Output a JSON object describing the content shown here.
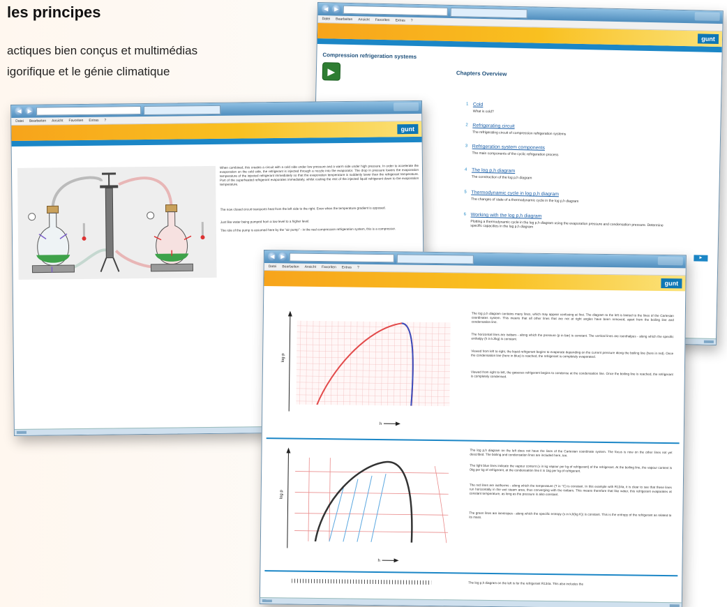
{
  "brochure": {
    "heading": "les principes",
    "line1": "actiques bien conçus et multimédias",
    "line2": "igorifique et le génie climatique"
  },
  "logo": "gunt",
  "menu": [
    "Datei",
    "Bearbeiten",
    "Ansicht",
    "Favoriten",
    "Extras",
    "?"
  ],
  "window_overview": {
    "document_title": "Compression refrigeration systems",
    "section_title": "Chapters Overview",
    "chapters": [
      {
        "num": "1",
        "title": "Cold",
        "desc": "What is cold?"
      },
      {
        "num": "2",
        "title": "Refrigerating circuit",
        "desc": "The refrigerating circuit of compression refrigeration systems"
      },
      {
        "num": "3",
        "title": "Refrigeration system components",
        "desc": "The main components of the cyclic refrigeration process"
      },
      {
        "num": "4",
        "title": "The log p,h diagram",
        "desc": "The construction of the log p,h diagram"
      },
      {
        "num": "5",
        "title": "Thermodynamic cycle in log p,h diagram",
        "desc": "The changes of state of a thermodynamic cycle in the log p,h diagram"
      },
      {
        "num": "6",
        "title": "Working with the log p,h diagram",
        "desc": "Plotting a thermodynamic cycle in the log p,h diagram using the evaporation pressure and condensation pressure. Determine specific capacities in the log p,h diagram"
      }
    ]
  },
  "window_circuit": {
    "paragraphs": [
      "When combined, this creates a circuit with a cold side under low pressure and a warm side under high pressure. In order to accelerate the evaporation on the cold side, the refrigerant is injected through a nozzle into the evaporator. The drop in pressure lowers the evaporation temperature of the injected refrigerant immediately so that the evaporation temperature is suddenly lower than the refrigerant temperature. Part of the superheated refrigerant evaporates immediately, whilst cooling the rest of the injected liquid refrigerant down to the evaporation temperature.",
      "The now closed circuit transports heat from the left side to the right. Even when the temperature gradient is opposed.",
      "Just like water being pumped from a low level to a higher level.",
      "The role of the pump is assumed here by the \"air pump\" - in the real compression refrigeration system, this is a compressor."
    ]
  },
  "window_diagram": {
    "axis_y": "log p",
    "axis_x": "h",
    "paragraphs_top": [
      "The log p,h diagram contains many lines, which may appear confusing at first. The diagram to the left is limited to the lines of the Cartesian coordinates system. This means that all other lines that are not at right angles have been removed, apart from the boiling line and condensation line.",
      "The horizontal lines are isobars - along which the pressure (p in bar) is constant. The vertical lines are isenthalpes - along which the specific enthalpy (h in kJ/kg) is constant.",
      "Viewed from left to right, the liquid refrigerant begins to evaporate depending on the current pressure along the boiling line (here in red). Once the condensation line (here in blue) is reached, the refrigerant is completely evaporated.",
      "Viewed from right to left, the gaseous refrigerant begins to condense at the condensation line. Once the boiling line is reached, the refrigerant is completely condensed."
    ],
    "paragraphs_bottom": [
      "The log p,h diagram on the left does not have the lines of the Cartesian coordinate system. The focus is now on the other lines not yet described. The boiling and condensation lines are included here, too.",
      "The light blue lines indicate the vapour content (x in kg vapour per kg of refrigerant) of the refrigerant. At the boiling line, the vapour content is 0kg per kg of refrigerant, at the condensation line it is 1kg per kg of refrigerant.",
      "The red lines are isotherms - along which the temperature (T in °C) is constant. In this example with R134a, it is clear to see that these lines run horizontally in the wet steam area, thus converging with the isobars. This means therefore that like water, this refrigerant evaporates at constant temperature, as long as the pressure is also constant.",
      "The green lines are isentropes - along which the specific entropy (s in kJ/(kg K)) is constant. This is the entropy of the refrigerant as related to its mass."
    ],
    "paragraph_partial": "The log p,h diagram on the left is for the refrigerant R134a. This also includes the"
  },
  "colors": {
    "accent_blue": "#1b86c6",
    "orange": "#f7a41b",
    "boiling_line": "#e24a4a",
    "condensation_line": "#3a4fbf"
  }
}
